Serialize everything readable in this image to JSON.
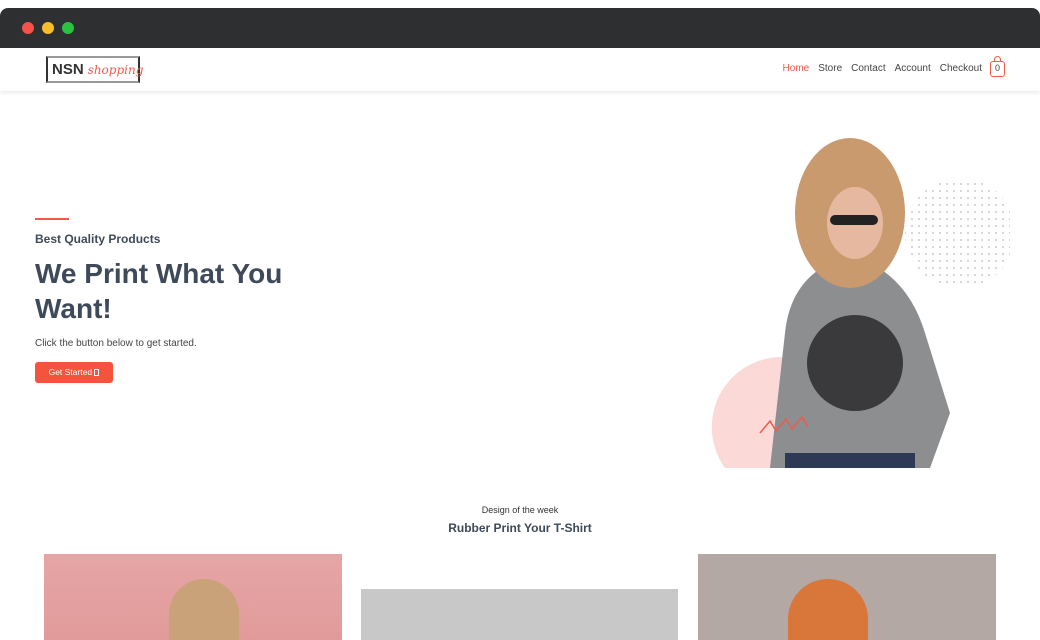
{
  "brand": {
    "primary": "NSN",
    "secondary": "shopping",
    "accent": "#f05a4a"
  },
  "nav": {
    "items": [
      "Home",
      "Store",
      "Contact",
      "Account",
      "Checkout"
    ],
    "active": "Home",
    "cart_count": "0"
  },
  "hero": {
    "kicker": "Best Quality Products",
    "title": "We Print What You Want!",
    "subtitle": "Click the button below to get started.",
    "button": "Get Started"
  },
  "section": {
    "eyebrow": "Design of the week",
    "title": "Rubber Print Your T-Shirt"
  }
}
